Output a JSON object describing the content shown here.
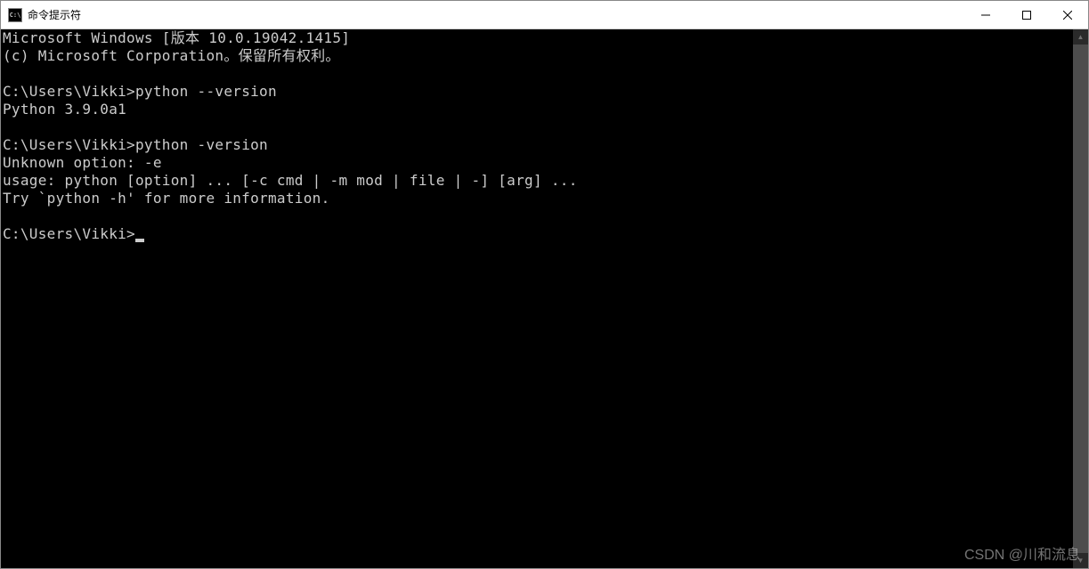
{
  "titlebar": {
    "icon_text": "C:\\",
    "title": "命令提示符"
  },
  "terminal": {
    "header_line": "Microsoft Windows [版本 10.0.19042.1415]",
    "copyright_line": "(c) Microsoft Corporation。保留所有权利。",
    "blank": "",
    "block1_prompt": "C:\\Users\\Vikki>",
    "block1_cmd": "python --version",
    "block1_out": "Python 3.9.0a1",
    "block2_prompt": "C:\\Users\\Vikki>",
    "block2_cmd": "python -version",
    "block2_out1": "Unknown option: -e",
    "block2_out2": "usage: python [option] ... [-c cmd | -m mod | file | -] [arg] ...",
    "block2_out3": "Try `python -h' for more information.",
    "final_prompt": "C:\\Users\\Vikki>"
  },
  "watermark": "CSDN @川和流息"
}
